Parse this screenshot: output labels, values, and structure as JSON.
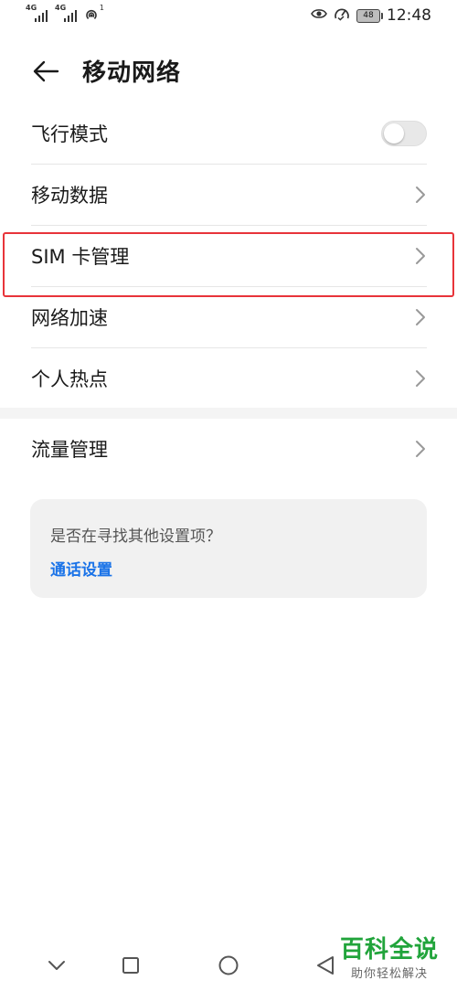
{
  "status_bar": {
    "signal_1_label": "4G",
    "signal_2_label": "4G",
    "hotspot_count": "1",
    "battery": "48",
    "time": "12:48"
  },
  "header": {
    "title": "移动网络"
  },
  "settings": {
    "items": [
      {
        "label": "飞行模式",
        "control": "toggle",
        "toggle_on": false
      },
      {
        "label": "移动数据",
        "control": "chevron"
      },
      {
        "label": "SIM 卡管理",
        "control": "chevron",
        "highlighted": true
      },
      {
        "label": "网络加速",
        "control": "chevron"
      },
      {
        "label": "个人热点",
        "control": "chevron"
      }
    ]
  },
  "settings2": {
    "items": [
      {
        "label": "流量管理",
        "control": "chevron"
      }
    ]
  },
  "suggestion": {
    "question": "是否在寻找其他设置项？",
    "link": "通话设置"
  },
  "watermark": {
    "title": "百科全说",
    "subtitle": "助你轻松解决"
  },
  "colors": {
    "accent": "#1a73e8",
    "highlight": "#e8343a",
    "watermark_green": "#21a43b"
  }
}
